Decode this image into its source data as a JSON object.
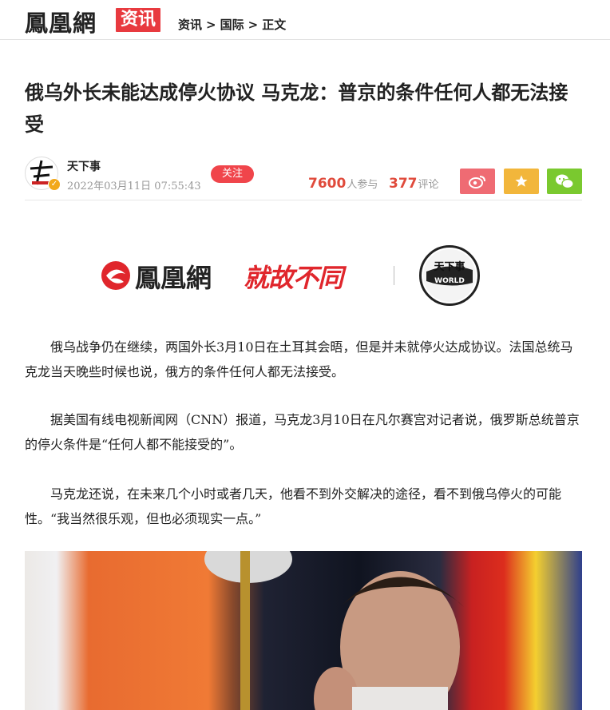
{
  "header": {
    "site_name": "鳳凰網",
    "channel_badge": "资讯",
    "breadcrumb": [
      "资讯",
      "国际",
      "正文"
    ],
    "breadcrumb_sep": ">"
  },
  "article": {
    "title": "俄乌外长未能达成停火协议 马克龙：普京的条件任何人都无法接受",
    "author": "天下事",
    "publish_time": "2022年03月11日 07:55:43",
    "follow_label": "关注",
    "participants_count": "7600",
    "participants_label": "人参与",
    "comments_count": "377",
    "comments_label": "评论"
  },
  "share": {
    "weibo_color": "#ef6b73",
    "favorite_color": "#f2b63b",
    "wechat_color": "#7ac92f"
  },
  "banner": {
    "logo_text": "鳳凰網",
    "slogan": "就故不同",
    "world_label": "WORLD",
    "circle_text": "天下事"
  },
  "paragraphs": [
    "俄乌战争仍在继续，两国外长3月10日在土耳其会晤，但是并未就停火达成协议。法国总统马克龙当天晚些时候也说，俄方的条件任何人都无法接受。",
    "据美国有线电视新闻网（CNN）报道，马克龙3月10日在凡尔赛宫对记者说，俄罗斯总统普京的停火条件是“任何人都不能接受的”。",
    "马克龙还说，在未来几个小时或者几天，他看不到外交解决的途径，看不到俄乌停火的可能性。“我当然很乐观，但也必须现实一点。”"
  ]
}
